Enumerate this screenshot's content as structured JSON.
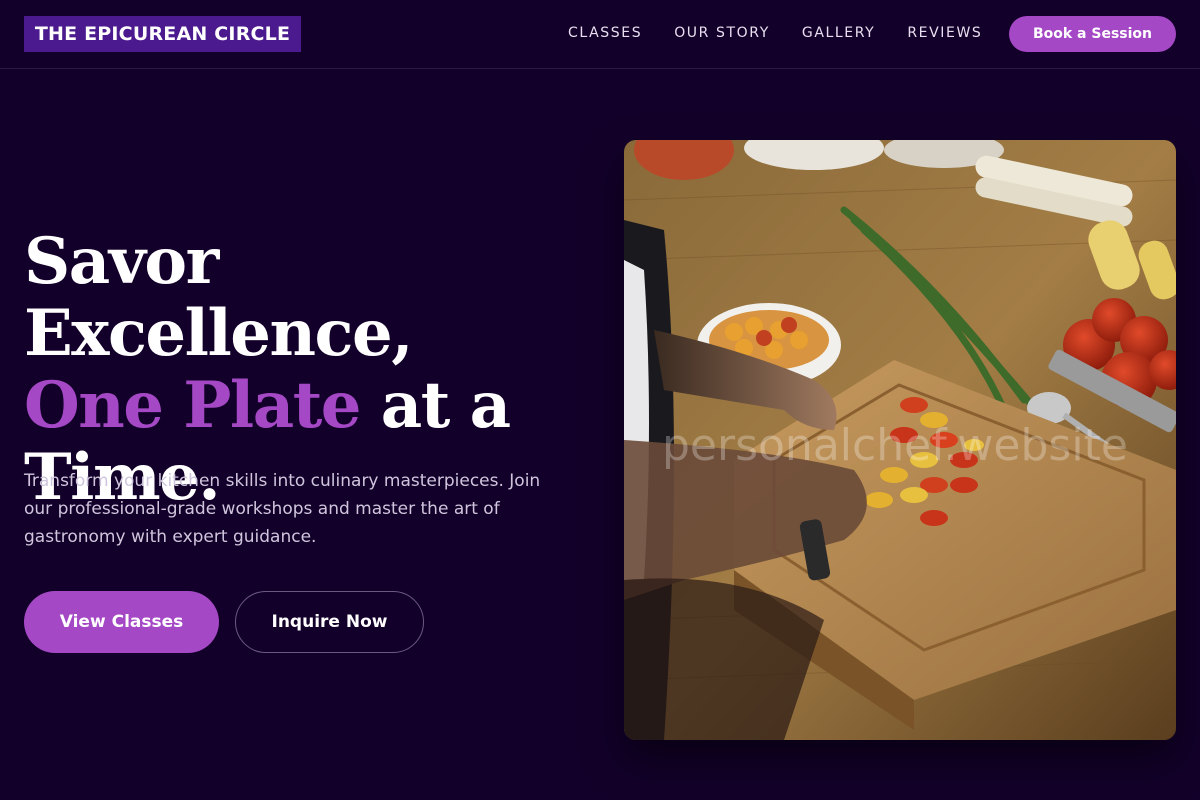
{
  "header": {
    "logo_text": "THE EPICUREAN CIRCLE",
    "nav": [
      "CLASSES",
      "OUR STORY",
      "GALLERY",
      "REVIEWS"
    ],
    "cta_label": "Book a Session"
  },
  "hero": {
    "headline_part1": "Savor Excellence,",
    "headline_accent": "One Plate",
    "headline_part2": " at a",
    "headline_part3": "Time.",
    "subtitle": "Transform your kitchen skills into culinary masterpieces. Join our professional-grade workshops and master the art of gastronomy with expert guidance.",
    "primary_button": "View Classes",
    "secondary_button": "Inquire Now",
    "image_watermark": "personalchef.website"
  },
  "colors": {
    "background": "#13002a",
    "accent": "#a548c6",
    "logo_bg": "#4a1a8e"
  }
}
